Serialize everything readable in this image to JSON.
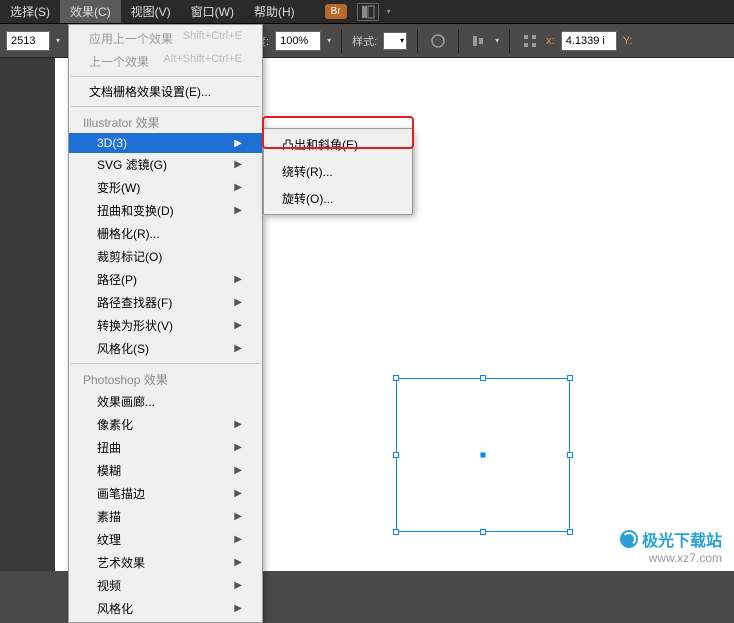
{
  "menubar": {
    "items": [
      {
        "label": "选择(S)"
      },
      {
        "label": "效果(C)"
      },
      {
        "label": "视图(V)"
      },
      {
        "label": "窗口(W)"
      },
      {
        "label": "帮助(H)"
      }
    ],
    "toolbar_badge": "Br"
  },
  "toolbar": {
    "num_value": "2513",
    "opacity_label": "不透明度:",
    "opacity_value": "100%",
    "style_label": "样式:",
    "coord_label": "x:",
    "coord_value": "4.1339 i",
    "coord_label2": "Y:"
  },
  "effects_menu": {
    "apply_last": {
      "label": "应用上一个效果",
      "shortcut": "Shift+Ctrl+E"
    },
    "last_effect": {
      "label": "上一个效果",
      "shortcut": "Alt+Shift+Ctrl+E"
    },
    "grid_settings": {
      "label": "文档栅格效果设置(E)..."
    },
    "group_ai": "Illustrator 效果",
    "ai_items": [
      {
        "label": "3D(3)"
      },
      {
        "label": "SVG 滤镜(G)"
      },
      {
        "label": "变形(W)"
      },
      {
        "label": "扭曲和变换(D)"
      },
      {
        "label": "栅格化(R)..."
      },
      {
        "label": "裁剪标记(O)"
      },
      {
        "label": "路径(P)"
      },
      {
        "label": "路径查找器(F)"
      },
      {
        "label": "转换为形状(V)"
      },
      {
        "label": "风格化(S)"
      }
    ],
    "group_ps": "Photoshop 效果",
    "ps_items": [
      {
        "label": "效果画廊..."
      },
      {
        "label": "像素化"
      },
      {
        "label": "扭曲"
      },
      {
        "label": "模糊"
      },
      {
        "label": "画笔描边"
      },
      {
        "label": "素描"
      },
      {
        "label": "纹理"
      },
      {
        "label": "艺术效果"
      },
      {
        "label": "视频"
      },
      {
        "label": "风格化"
      }
    ]
  },
  "submenu_3d": {
    "items": [
      {
        "label": "凸出和斜角(E)..."
      },
      {
        "label": "绕转(R)..."
      },
      {
        "label": "旋转(O)..."
      }
    ]
  },
  "watermark": {
    "brand": "极光下载站",
    "url": "www.xz7.com"
  }
}
